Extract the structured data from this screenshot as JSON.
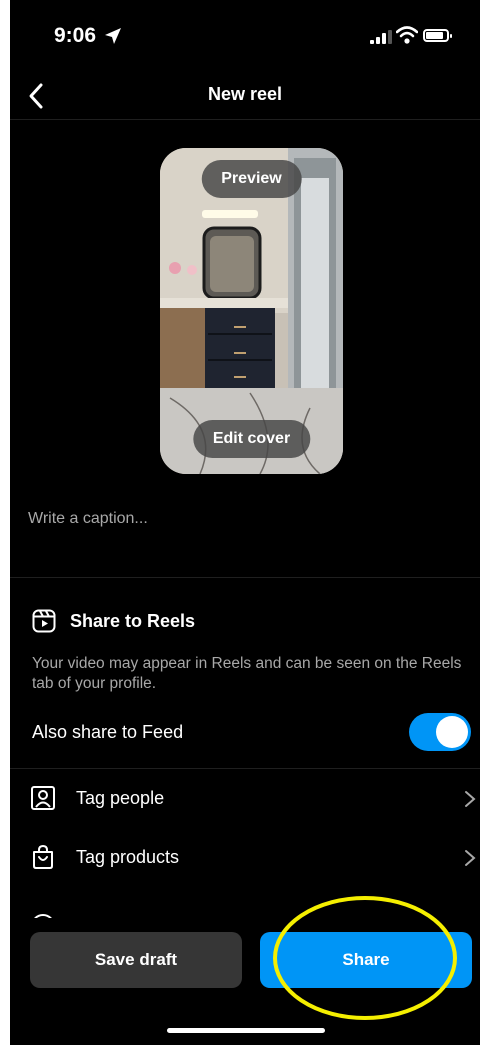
{
  "status_bar": {
    "time": "9:06"
  },
  "header": {
    "title": "New reel"
  },
  "cover": {
    "preview_label": "Preview",
    "edit_cover_label": "Edit cover"
  },
  "caption": {
    "placeholder": "Write a caption..."
  },
  "reels": {
    "title": "Share to Reels",
    "description": "Your video may appear in Reels and can be seen on the Reels tab of your profile.",
    "feed_label": "Also share to Feed",
    "feed_enabled": true
  },
  "options": {
    "tag_people": "Tag people",
    "tag_products": "Tag products"
  },
  "actions": {
    "save_draft": "Save draft",
    "share": "Share"
  },
  "colors": {
    "accent": "#0095f6",
    "annotation": "#f5ef00"
  }
}
